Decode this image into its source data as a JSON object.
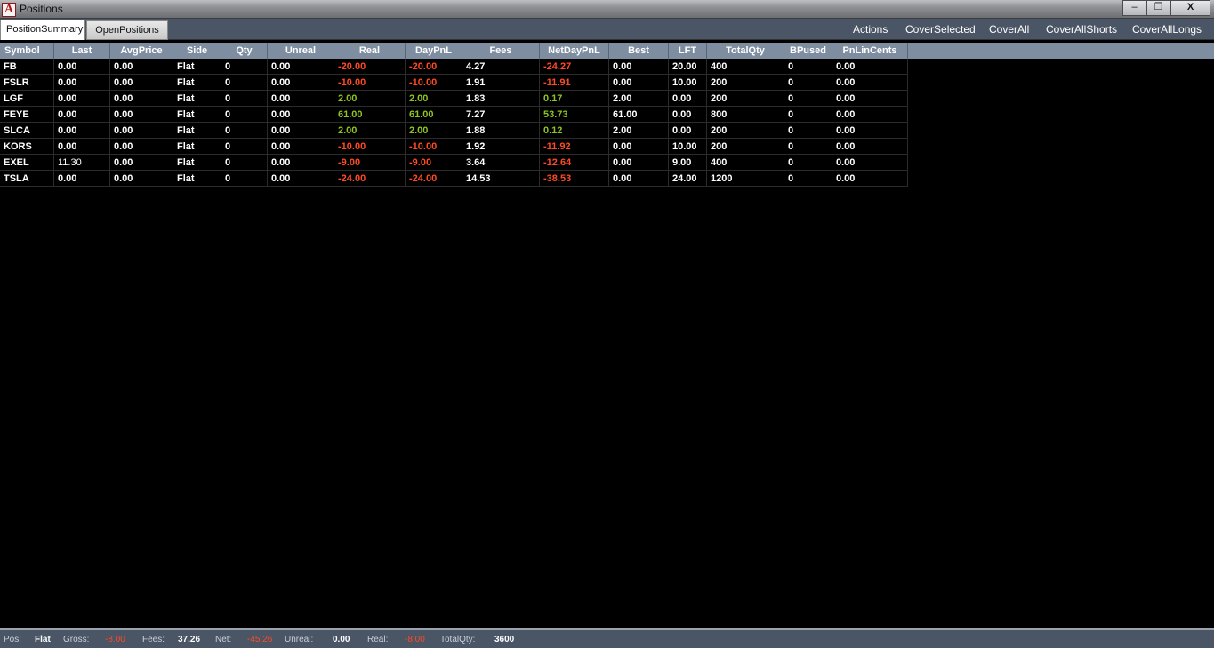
{
  "window": {
    "title": "Positions",
    "app_icon_letter": "A"
  },
  "window_controls": {
    "minimize": "‒",
    "restore": "❐",
    "close": "X"
  },
  "tabs": [
    {
      "label": "PositionSummary",
      "active": true
    },
    {
      "label": "OpenPositions",
      "active": false
    }
  ],
  "actions": [
    "Actions",
    "CoverSelected",
    "CoverAll",
    "CoverAllShorts",
    "CoverAllLongs"
  ],
  "columns": [
    "Symbol",
    "Last",
    "AvgPrice",
    "Side",
    "Qty",
    "Unreal",
    "Real",
    "DayPnL",
    "Fees",
    "NetDayPnL",
    "Best",
    "LFT",
    "TotalQty",
    "BPused",
    "PnLinCents"
  ],
  "rows": [
    [
      "FB",
      "0.00",
      "0.00",
      "Flat",
      "0",
      "0.00",
      "-20.00",
      "-20.00",
      "4.27",
      "-24.27",
      "0.00",
      "20.00",
      "400",
      "0",
      "0.00"
    ],
    [
      "FSLR",
      "0.00",
      "0.00",
      "Flat",
      "0",
      "0.00",
      "-10.00",
      "-10.00",
      "1.91",
      "-11.91",
      "0.00",
      "10.00",
      "200",
      "0",
      "0.00"
    ],
    [
      "LGF",
      "0.00",
      "0.00",
      "Flat",
      "0",
      "0.00",
      "2.00",
      "2.00",
      "1.83",
      "0.17",
      "2.00",
      "0.00",
      "200",
      "0",
      "0.00"
    ],
    [
      "FEYE",
      "0.00",
      "0.00",
      "Flat",
      "0",
      "0.00",
      "61.00",
      "61.00",
      "7.27",
      "53.73",
      "61.00",
      "0.00",
      "800",
      "0",
      "0.00"
    ],
    [
      "SLCA",
      "0.00",
      "0.00",
      "Flat",
      "0",
      "0.00",
      "2.00",
      "2.00",
      "1.88",
      "0.12",
      "2.00",
      "0.00",
      "200",
      "0",
      "0.00"
    ],
    [
      "KORS",
      "0.00",
      "0.00",
      "Flat",
      "0",
      "0.00",
      "-10.00",
      "-10.00",
      "1.92",
      "-11.92",
      "0.00",
      "10.00",
      "200",
      "0",
      "0.00"
    ],
    [
      "EXEL",
      "11.30",
      "0.00",
      "Flat",
      "0",
      "0.00",
      "-9.00",
      "-9.00",
      "3.64",
      "-12.64",
      "0.00",
      "9.00",
      "400",
      "0",
      "0.00"
    ],
    [
      "TSLA",
      "0.00",
      "0.00",
      "Flat",
      "0",
      "0.00",
      "-24.00",
      "-24.00",
      "14.53",
      "-38.53",
      "0.00",
      "24.00",
      "1200",
      "0",
      "0.00"
    ]
  ],
  "status": [
    {
      "label": "Pos:",
      "value": "Flat"
    },
    {
      "label": "Gross:",
      "value": "-8.00"
    },
    {
      "label": "Fees:",
      "value": "37.26"
    },
    {
      "label": "Net:",
      "value": "-45.26"
    },
    {
      "label": "Unreal:",
      "value": "0.00"
    },
    {
      "label": "Real:",
      "value": "-8.00"
    },
    {
      "label": "TotalQty:",
      "value": "3600"
    }
  ],
  "colors": {
    "negative": "#ff4a25",
    "positive": "#8fc31f",
    "header": "#7f8da0",
    "toolbar": "#4a5565"
  }
}
